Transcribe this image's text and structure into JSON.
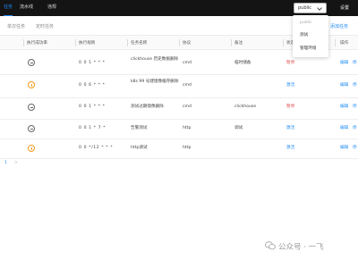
{
  "topbar": {
    "nav": [
      {
        "label": "任务",
        "active": true
      },
      {
        "label": "流水线",
        "active": false
      },
      {
        "label": "违规",
        "active": false
      }
    ],
    "namespace": {
      "value": "public"
    },
    "settings_label": "设置"
  },
  "subtabs": {
    "items": [
      "单次任务",
      "定时任务"
    ],
    "add_label": "添加任务"
  },
  "table": {
    "columns": [
      "执行成功率",
      "执行规则",
      "任务名称",
      "协议",
      "备注",
      "状态",
      "操作"
    ],
    "rows": [
      {
        "status": "ok",
        "rule": "0 0 1 * * *",
        "name": "clickhouse 历史数据删除",
        "protocol": "cmd",
        "note": "临时储备",
        "state": "暂停",
        "state_color": "red",
        "actions": [
          "编辑",
          "停"
        ]
      },
      {
        "status": "warn",
        "rule": "0 0 6 * * *",
        "name": "k8s 99 号建镜像缓存删除",
        "protocol": "cmd",
        "note": "",
        "state": "激活",
        "state_color": "blue",
        "actions": [
          "编辑",
          "停"
        ]
      },
      {
        "status": "ok",
        "rule": "0 0 1 * * *",
        "name": "测试过期镜像删除",
        "protocol": "cmd",
        "note": "clickhouse",
        "state": "暂停",
        "state_color": "red",
        "actions": [
          "编辑",
          "停"
        ]
      },
      {
        "status": "ok",
        "rule": "0 0 1 * 7 *",
        "name": "告警测试",
        "protocol": "http",
        "note": "调试",
        "state": "激活",
        "state_color": "blue",
        "actions": [
          "编辑",
          "停"
        ]
      },
      {
        "status": "warn",
        "rule": "0 0 */12 * * *",
        "name": "http调试",
        "protocol": "http",
        "note": "",
        "state": "激活",
        "state_color": "blue",
        "actions": [
          "编辑",
          "停"
        ]
      }
    ]
  },
  "pager": {
    "current": "1",
    "next": ">"
  },
  "dropdown": {
    "items": [
      {
        "label": "public",
        "muted": true
      },
      {
        "label": "测试",
        "muted": false
      },
      {
        "label": "管理环境",
        "muted": false
      }
    ]
  },
  "watermark": {
    "text": "公众号 · 一飞"
  },
  "colors": {
    "accent": "#1f8bf5",
    "topbar_bg": "#141414",
    "warn": "#f29b20",
    "danger": "#e04b4b"
  }
}
